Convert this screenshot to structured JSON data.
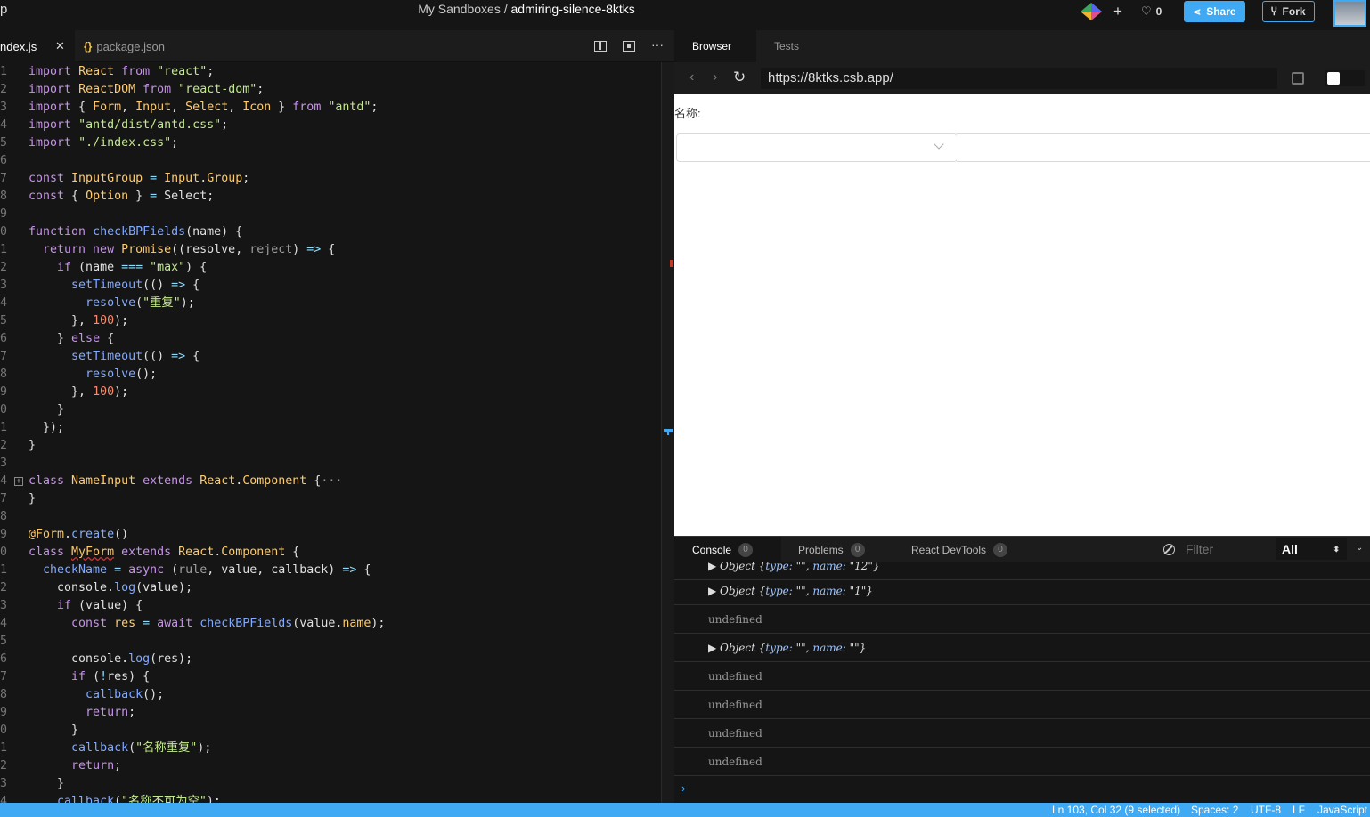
{
  "topbar": {
    "logo_char": "p",
    "breadcrumb": "My Sandboxes / ",
    "sandbox_name": "admiring-silence-8ktks",
    "likes": "0",
    "share_label": "Share",
    "fork_label": "Fork"
  },
  "editor": {
    "tabs": [
      {
        "label": "ndex.js"
      },
      {
        "label": "package.json"
      }
    ],
    "line_numbers": [
      "1",
      "2",
      "3",
      "4",
      "5",
      "6",
      "7",
      "8",
      "9",
      "0",
      "1",
      "2",
      "3",
      "4",
      "5",
      "6",
      "7",
      "8",
      "9",
      "0",
      "1",
      "2",
      "3",
      "4",
      "7",
      "8",
      "9",
      "0",
      "1",
      "2",
      "3",
      "4",
      "5",
      "6",
      "7",
      "8",
      "9",
      "0",
      "1",
      "2",
      "3",
      "4"
    ]
  },
  "preview": {
    "tabs": [
      "Browser",
      "Tests"
    ],
    "url": "https://8ktks.csb.app/",
    "form_label": "名称:"
  },
  "console": {
    "tabs": [
      {
        "label": "Console",
        "count": "0"
      },
      {
        "label": "Problems",
        "count": "0"
      },
      {
        "label": "React DevTools",
        "count": "0"
      }
    ],
    "filter_placeholder": "Filter",
    "level": "All",
    "prompt": "›",
    "rows": [
      {
        "kind": "object",
        "name_value": "\"12\""
      },
      {
        "kind": "object",
        "name_value": "\"1\""
      },
      {
        "kind": "undefined",
        "text": "undefined"
      },
      {
        "kind": "object",
        "name_value": "\"\""
      },
      {
        "kind": "undefined",
        "text": "undefined"
      },
      {
        "kind": "undefined",
        "text": "undefined"
      },
      {
        "kind": "undefined",
        "text": "undefined"
      },
      {
        "kind": "undefined",
        "text": "undefined"
      }
    ]
  },
  "statusbar": {
    "position": "Ln 103, Col 32 (9 selected)",
    "spaces": "Spaces: 2",
    "encoding": "UTF-8",
    "eol": "LF",
    "language": "JavaScript"
  }
}
